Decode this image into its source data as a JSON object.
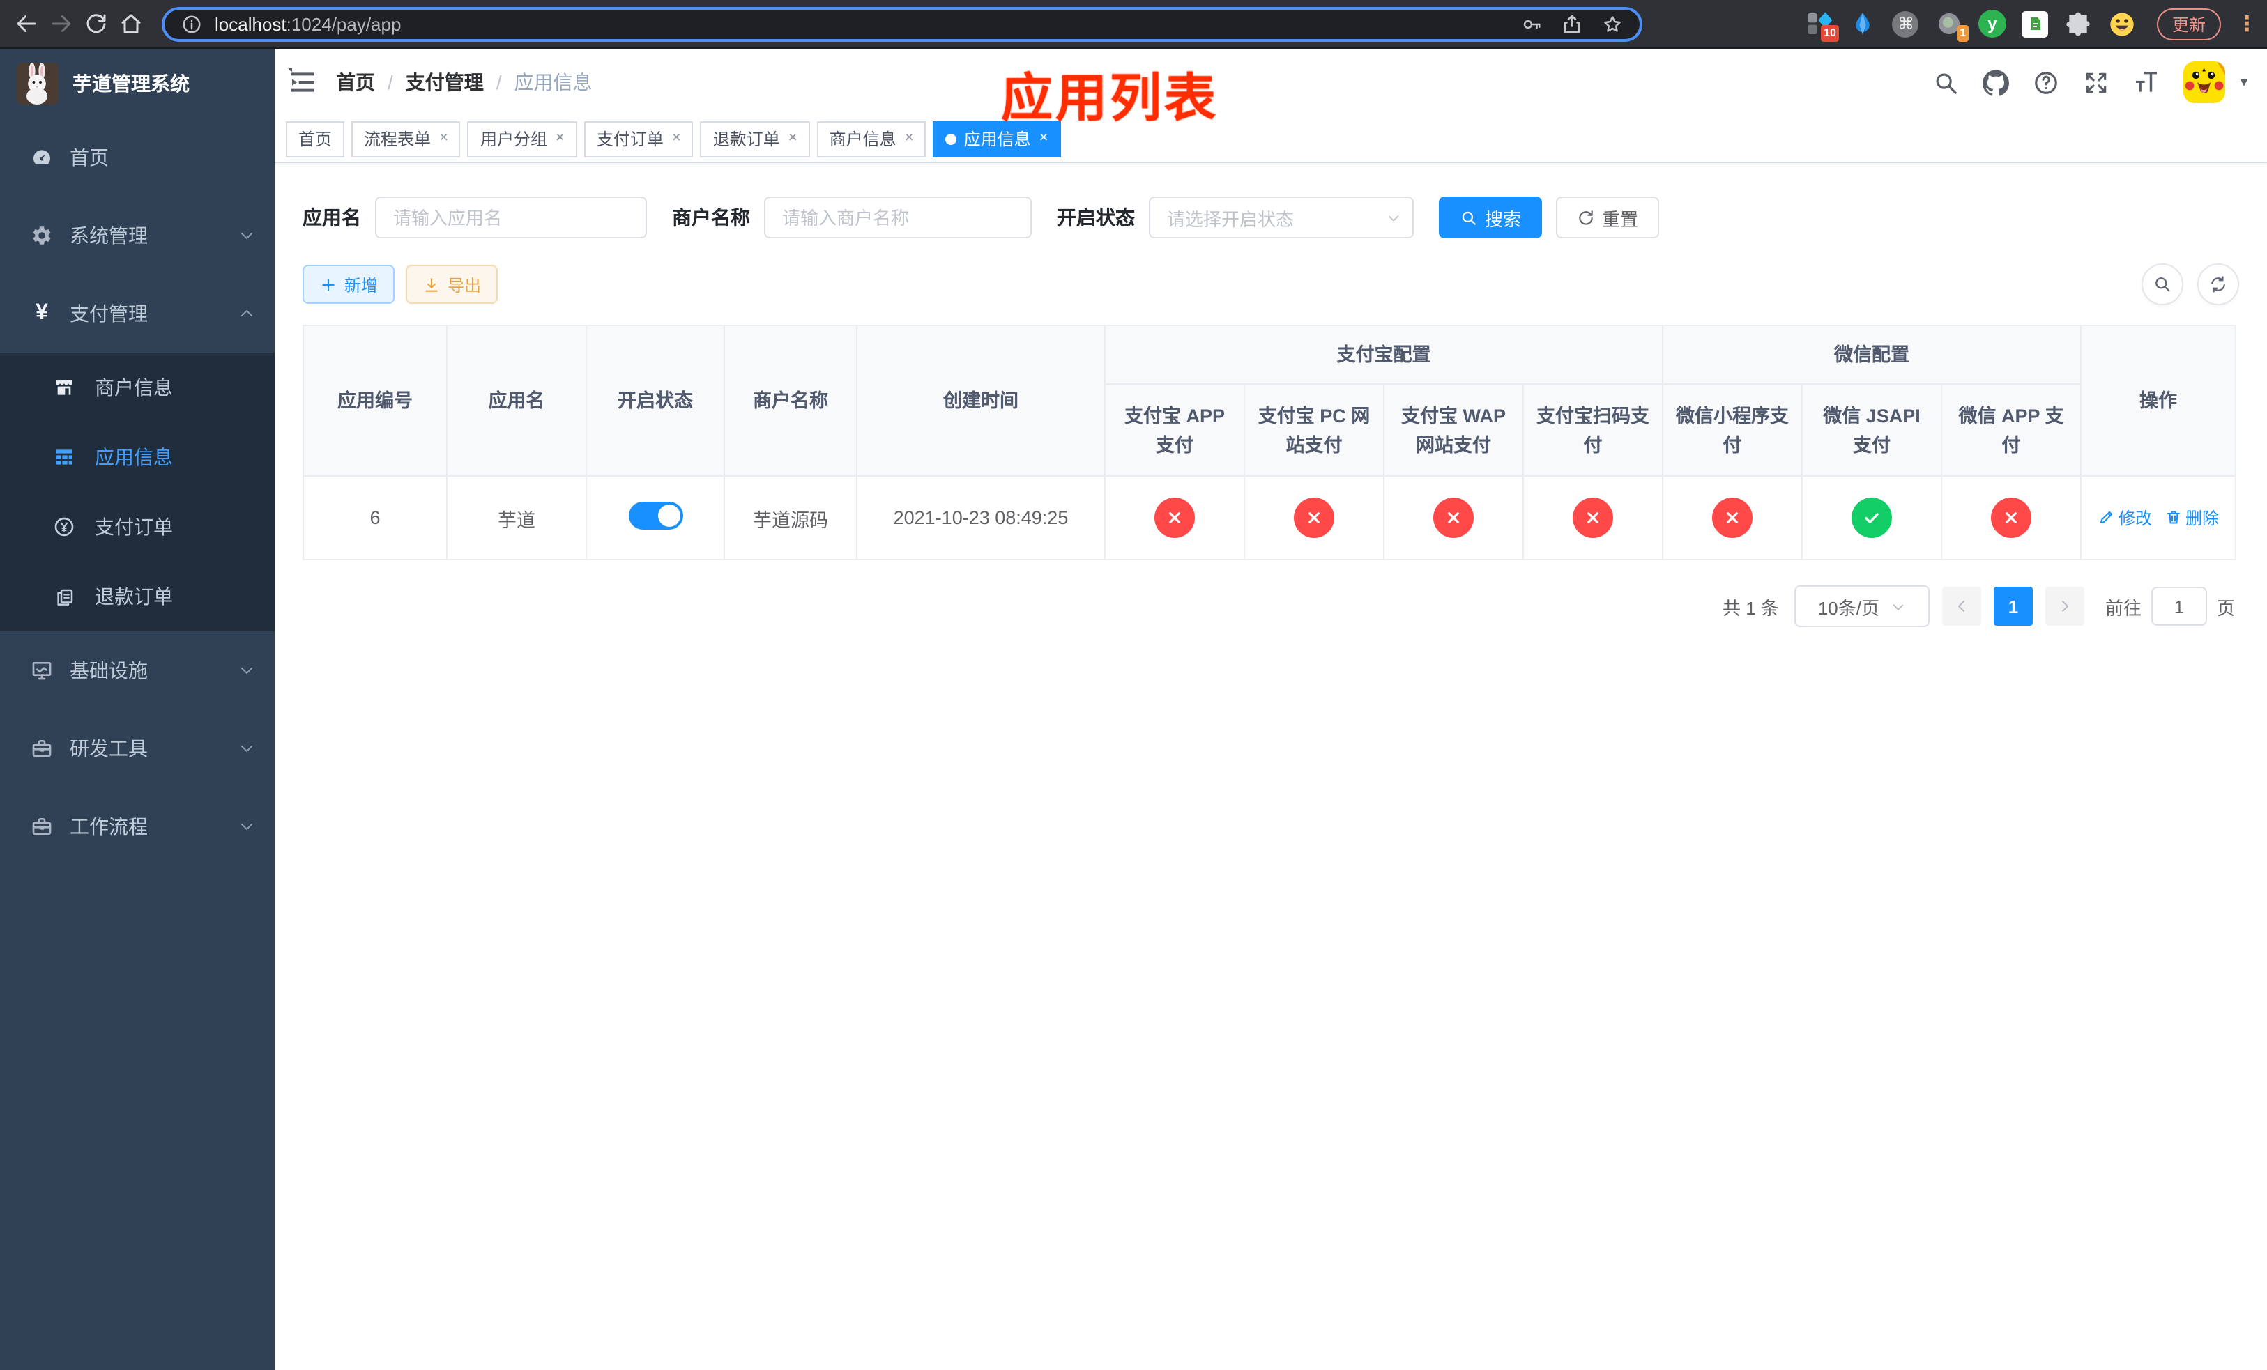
{
  "browser": {
    "url_host": "localhost",
    "url_rest": ":1024/pay/app",
    "update_label": "更新",
    "ext_badge_ten": "10",
    "ext_badge_one": "1",
    "ext_letter_y": "y"
  },
  "icons": {
    "cmd_glyph": "⌘",
    "menu_dots_glyph": "⋮",
    "caret_glyph": "▾",
    "breadcrumb_sep": "/"
  },
  "sidebar": {
    "title": "芋道管理系统",
    "menu_home": "首页",
    "menu_system": "系统管理",
    "menu_pay": "支付管理",
    "sub_merchant": "商户信息",
    "sub_app": "应用信息",
    "sub_order": "支付订单",
    "sub_refund": "退款订单",
    "menu_infra": "基础设施",
    "menu_dev": "研发工具",
    "menu_flow": "工作流程"
  },
  "navbar": {
    "breadcrumb": [
      "首页",
      "支付管理",
      "应用信息"
    ],
    "annotation": "应用列表"
  },
  "tabs": [
    {
      "label": "首页",
      "closable": false,
      "active": false
    },
    {
      "label": "流程表单",
      "closable": true,
      "active": false
    },
    {
      "label": "用户分组",
      "closable": true,
      "active": false
    },
    {
      "label": "支付订单",
      "closable": true,
      "active": false
    },
    {
      "label": "退款订单",
      "closable": true,
      "active": false
    },
    {
      "label": "商户信息",
      "closable": true,
      "active": false
    },
    {
      "label": "应用信息",
      "closable": true,
      "active": true
    }
  ],
  "filter": {
    "app_name_label": "应用名",
    "app_name_placeholder": "请输入应用名",
    "merchant_label": "商户名称",
    "merchant_placeholder": "请输入商户名称",
    "status_label": "开启状态",
    "status_placeholder": "请选择开启状态",
    "search_label": "搜索",
    "reset_label": "重置"
  },
  "toolbar": {
    "add_label": "新增",
    "export_label": "导出"
  },
  "table": {
    "col_id": "应用编号",
    "col_name": "应用名",
    "col_status": "开启状态",
    "col_merchant": "商户名称",
    "col_created": "创建时间",
    "group_alipay": "支付宝配置",
    "group_wechat": "微信配置",
    "col_alipay_app": "支付宝 APP 支付",
    "col_alipay_pc": "支付宝 PC 网站支付",
    "col_alipay_wap": "支付宝 WAP 网站支付",
    "col_alipay_qr": "支付宝扫码支付",
    "col_wx_mini": "微信小程序支付",
    "col_wx_jsapi": "微信 JSAPI 支付",
    "col_wx_app": "微信 APP 支付",
    "col_ops": "操作",
    "row": {
      "id": "6",
      "name": "芋道",
      "enabled": true,
      "merchant": "芋道源码",
      "created": "2021-10-23 08:49:25",
      "statuses": [
        "cross",
        "cross",
        "cross",
        "cross",
        "cross",
        "check",
        "cross"
      ],
      "edit_label": "修改",
      "delete_label": "删除"
    }
  },
  "pagination": {
    "total": "共 1 条",
    "page_size": "10条/页",
    "page": "1",
    "goto_label": "前往",
    "goto_value": "1",
    "page_unit": "页"
  }
}
